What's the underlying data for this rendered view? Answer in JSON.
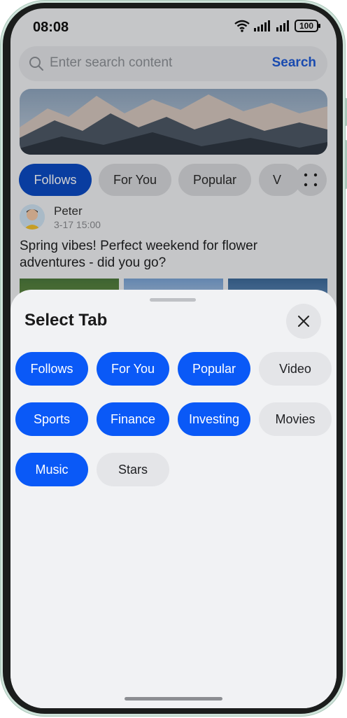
{
  "status_bar": {
    "time": "08:08",
    "battery": "100"
  },
  "search": {
    "placeholder": "Enter search content",
    "button_label": "Search"
  },
  "top_tabs": [
    {
      "label": "Follows",
      "active": true
    },
    {
      "label": "For You",
      "active": false
    },
    {
      "label": "Popular",
      "active": false
    },
    {
      "label": "V",
      "active": false
    }
  ],
  "post": {
    "author": "Peter",
    "time": "3-17 15:00",
    "text": "Spring vibes! Perfect weekend for flower adventures - did you go?"
  },
  "sheet": {
    "title": "Select Tab",
    "tabs": [
      {
        "label": "Follows",
        "selected": true
      },
      {
        "label": "For You",
        "selected": true
      },
      {
        "label": "Popular",
        "selected": true
      },
      {
        "label": "Video",
        "selected": false
      },
      {
        "label": "Sports",
        "selected": true
      },
      {
        "label": "Finance",
        "selected": true
      },
      {
        "label": "Investing",
        "selected": true
      },
      {
        "label": "Movies",
        "selected": false
      },
      {
        "label": "Music",
        "selected": true
      },
      {
        "label": "Stars",
        "selected": false
      }
    ]
  },
  "colors": {
    "accent": "#0a59f7",
    "active_tab": "#0c4bc4",
    "search_link": "#1f5bd6"
  }
}
